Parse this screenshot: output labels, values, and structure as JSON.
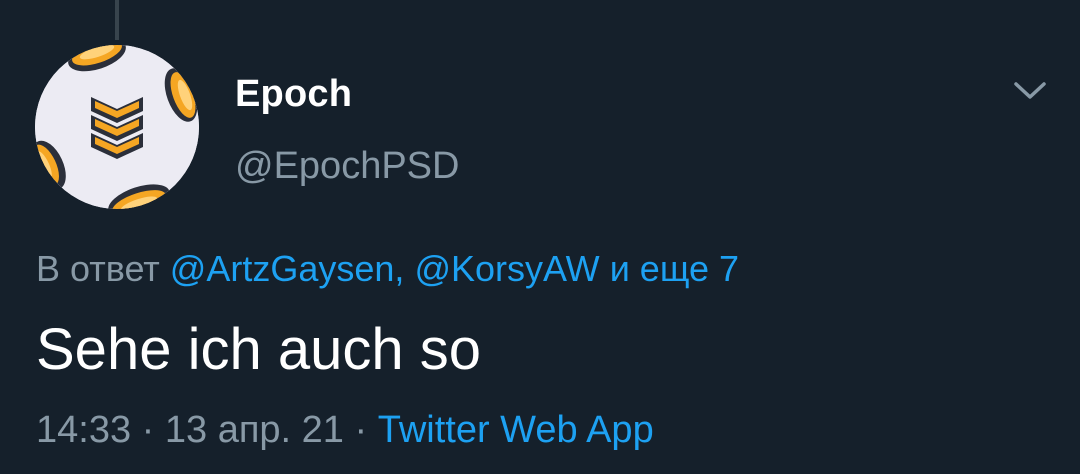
{
  "tweet": {
    "author": {
      "display_name": "Epoch",
      "handle": "@EpochPSD",
      "avatar_icon": "epoch-chevron-logo-icon"
    },
    "reply": {
      "prefix": "В ответ",
      "mentions": [
        "@ArtzGaysen,",
        "@KorsyAW"
      ],
      "suffix": "и еще 7"
    },
    "text": "Sehe ich auch so",
    "meta": {
      "time": "14:33",
      "separator": "·",
      "date": "13 апр. 21",
      "source": "Twitter Web App"
    },
    "menu_icon": "chevron-down-icon"
  },
  "colors": {
    "background": "#15202b",
    "text_primary": "#ffffff",
    "text_secondary": "#8899a6",
    "accent": "#1da1f2",
    "thread_line": "#38444d",
    "logo_orange": "#f5a623",
    "logo_dark": "#2b2f3a"
  }
}
